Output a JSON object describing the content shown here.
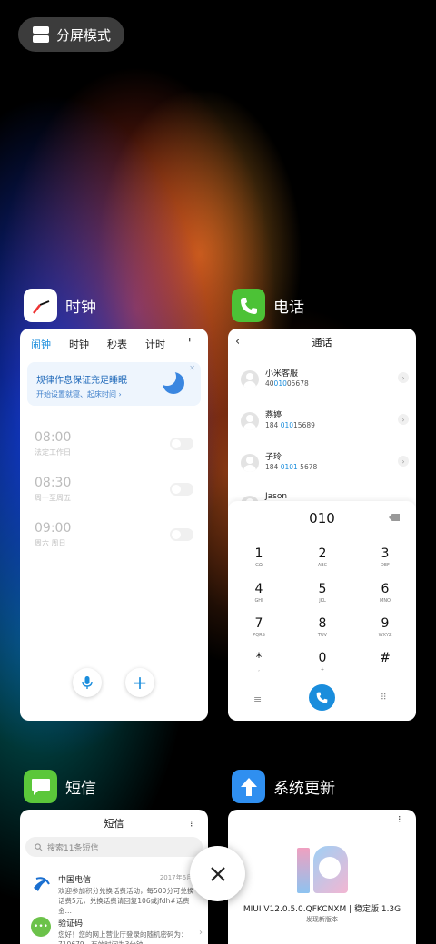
{
  "split_button": {
    "label": "分屏模式"
  },
  "clock": {
    "app_name": "时钟",
    "tabs": [
      "闹钟",
      "时钟",
      "秒表",
      "计时"
    ],
    "banner": {
      "title": "规律作息保证充足睡眠",
      "subtitle": "开始设置就寝、起床时间 ›"
    },
    "alarms": [
      {
        "time": "08:00",
        "repeat": "法定工作日"
      },
      {
        "time": "08:30",
        "repeat": "周一至周五"
      },
      {
        "time": "09:00",
        "repeat": "周六 周日"
      }
    ]
  },
  "phone": {
    "app_name": "电话",
    "title": "通话",
    "contacts": [
      {
        "name": "小米客服",
        "num_a": "40",
        "num_hl": "010",
        "num_b": "05678"
      },
      {
        "name": "燕婷",
        "num_a": "184 ",
        "num_hl": "010",
        "num_b": "15689"
      },
      {
        "name": "子玲",
        "num_a": "184 ",
        "num_hl": "0101",
        "num_b": " 5678"
      },
      {
        "name": "Jason",
        "num_a": "",
        "num_hl": "",
        "num_b": ""
      }
    ],
    "dial_input": "010",
    "keys": [
      {
        "d": "1",
        "l": "GΩ"
      },
      {
        "d": "2",
        "l": "ABC"
      },
      {
        "d": "3",
        "l": "DEF"
      },
      {
        "d": "4",
        "l": "GHI"
      },
      {
        "d": "5",
        "l": "JKL"
      },
      {
        "d": "6",
        "l": "MNO"
      },
      {
        "d": "7",
        "l": "PQRS"
      },
      {
        "d": "8",
        "l": "TUV"
      },
      {
        "d": "9",
        "l": "WXYZ"
      },
      {
        "d": "*",
        "l": ","
      },
      {
        "d": "0",
        "l": "+"
      },
      {
        "d": "#",
        "l": ""
      }
    ]
  },
  "sms": {
    "app_name": "短信",
    "title": "短信",
    "search_placeholder": "搜索11条短信",
    "messages": [
      {
        "sender": "中国电信",
        "date": "2017年6月30",
        "preview": "欢迎参加积分兑换话费活动，每500分可兑换话费5元，兑换话费请回复106或jfdh#话费金…"
      },
      {
        "sender": "验证码",
        "date": "",
        "preview": "您好！您的网上营业厅登录的随机密码为：710679，有效时间为3分钟"
      }
    ]
  },
  "update": {
    "app_name": "系统更新",
    "version": "MIUI V12.0.5.0.QFKCNXM | 稳定版 1.3G",
    "status": "发现新版本"
  },
  "colors": {
    "accent": "#1a8ddc",
    "phone_green": "#4cc236",
    "sms_green": "#5bc73a",
    "update_blue": "#2f8ff0"
  }
}
